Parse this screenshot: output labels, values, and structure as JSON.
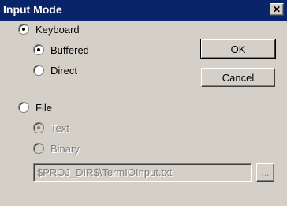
{
  "window": {
    "title": "Input Mode",
    "close_glyph": "✕"
  },
  "options": {
    "keyboard": {
      "label": "Keyboard",
      "checked": true
    },
    "buffered": {
      "label": "Buffered",
      "checked": true
    },
    "direct": {
      "label": "Direct",
      "checked": false
    },
    "file": {
      "label": "File",
      "checked": false
    },
    "text": {
      "label": "Text",
      "checked": true,
      "disabled": true
    },
    "binary": {
      "label": "Binary",
      "checked": false,
      "disabled": true
    }
  },
  "buttons": {
    "ok": "OK",
    "cancel": "Cancel",
    "browse": "..."
  },
  "file_path": {
    "value": "$PROJ_DIR$\\TermIOInput.txt"
  },
  "colors": {
    "title_bar": "#0A246A",
    "dialog_bg": "#D4D0C8",
    "disabled_text": "#808080"
  }
}
